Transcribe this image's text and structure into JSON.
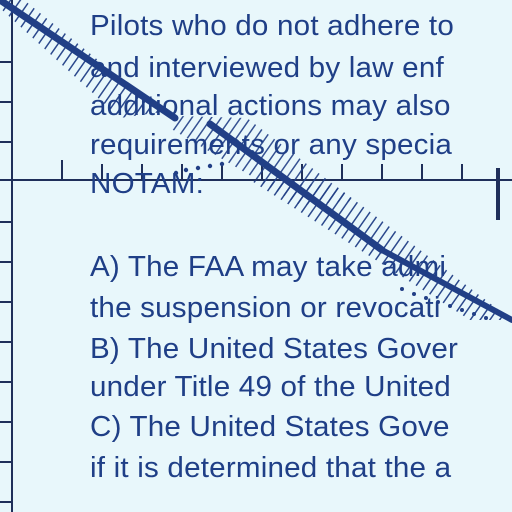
{
  "document": {
    "line_top_cut": "",
    "line_1": "Pilots who do not adhere to",
    "line_2": "and interviewed by law enf",
    "line_3": "additional actions may also",
    "line_4": "requirements or any specia",
    "line_5": "NOTAM:",
    "line_6": "A) The FAA may take admi",
    "line_7": "the suspension or revocati",
    "line_8": "B) The United States Gover",
    "line_9": "under Title 49 of the United",
    "line_10": "C) The United States Gove",
    "line_11": "if it is determined that the a"
  },
  "colors": {
    "background": "#e8f7fb",
    "ink": "#1f3f87",
    "grid": "#1f2f5a"
  }
}
